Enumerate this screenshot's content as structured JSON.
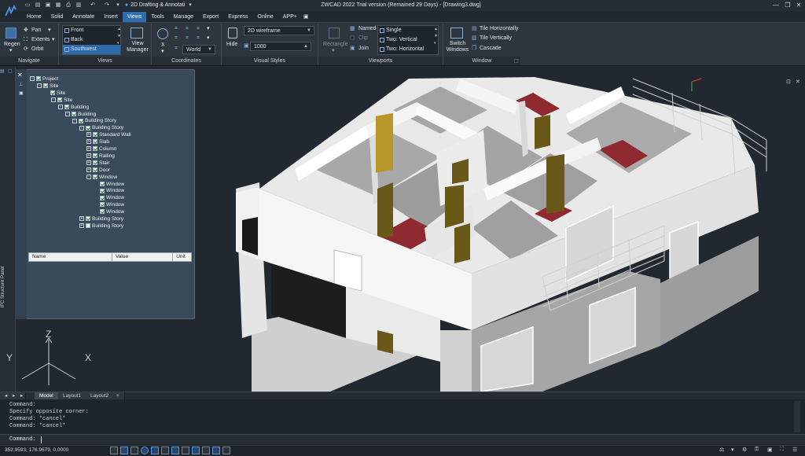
{
  "titlebar": {
    "workspace": "2D Drafting & Annotati",
    "app_title": "ZWCAD 2022 Trial version (Remained 29 Days) - [Drawing3.dwg]"
  },
  "menu": [
    "Home",
    "Solid",
    "Annotate",
    "Insert",
    "Views",
    "Tools",
    "Manage",
    "Export",
    "Express",
    "Online",
    "APP+"
  ],
  "menu_active": "Views",
  "ribbon": {
    "navigate": {
      "label": "Navigate",
      "regen": "Regen",
      "pan": "Pan",
      "extents": "Extents",
      "orbit": "Orbit"
    },
    "views": {
      "label": "Views",
      "items": [
        "Front",
        "Back",
        "Southwest"
      ],
      "selected": "Southwest",
      "view_manager": "View\nManager"
    },
    "coordinates": {
      "label": "Coordinates",
      "x": "X",
      "ucs": "World"
    },
    "visual_styles": {
      "label": "Visual Styles",
      "hide": "Hide",
      "style": "2D wireframe",
      "value": "1000"
    },
    "viewports": {
      "label": "Viewports",
      "rectangle": "Rectangle",
      "named": "Named",
      "clip": "Clip",
      "join": "Join",
      "single": "Single",
      "two_vertical": "Two: Vertical",
      "two_horizontal": "Two: Horizontal"
    },
    "window": {
      "label": "Window",
      "switch": "Switch\nWindows",
      "tile_h": "Tile Horizontally",
      "tile_v": "Tile Vertically",
      "cascade": "Cascade"
    }
  },
  "panel": {
    "title": "IFC Structure Panel",
    "tree": [
      {
        "label": "Project",
        "level": 0,
        "pm": "-",
        "checked": true
      },
      {
        "label": "Site",
        "level": 1,
        "pm": "-",
        "checked": true
      },
      {
        "label": "Site",
        "level": 2,
        "pm": "",
        "checked": true
      },
      {
        "label": "Site",
        "level": 3,
        "pm": "-",
        "checked": true
      },
      {
        "label": "Building",
        "level": 4,
        "pm": "-",
        "checked": true
      },
      {
        "label": "Building",
        "level": 5,
        "pm": "-",
        "checked": true
      },
      {
        "label": "Building Story",
        "level": 6,
        "pm": "-",
        "checked": true
      },
      {
        "label": "Building Story",
        "level": 7,
        "pm": "-",
        "checked": true
      },
      {
        "label": "Standard Wall",
        "level": 8,
        "pm": "+",
        "checked": true
      },
      {
        "label": "Slab",
        "level": 8,
        "pm": "+",
        "checked": true
      },
      {
        "label": "Column",
        "level": 8,
        "pm": "+",
        "checked": true
      },
      {
        "label": "Railing",
        "level": 8,
        "pm": "+",
        "checked": true
      },
      {
        "label": "Stair",
        "level": 8,
        "pm": "+",
        "checked": true
      },
      {
        "label": "Door",
        "level": 8,
        "pm": "+",
        "checked": true
      },
      {
        "label": "Window",
        "level": 8,
        "pm": "-",
        "checked": true
      },
      {
        "label": "Window",
        "level": 9,
        "pm": "",
        "checked": true
      },
      {
        "label": "Window",
        "level": 9,
        "pm": "",
        "checked": true
      },
      {
        "label": "Window",
        "level": 9,
        "pm": "",
        "checked": true
      },
      {
        "label": "Window",
        "level": 9,
        "pm": "",
        "checked": true
      },
      {
        "label": "Window",
        "level": 9,
        "pm": "",
        "checked": true
      },
      {
        "label": "Building Story",
        "level": 7,
        "pm": "+",
        "checked": true
      },
      {
        "label": "Building Story",
        "level": 7,
        "pm": "+",
        "checked": false
      }
    ],
    "props_headers": [
      "Name",
      "Value",
      "Unit"
    ]
  },
  "ucs": {
    "z": "Z",
    "y": "Y",
    "x": "X"
  },
  "layout_tabs": [
    "Model",
    "Layout1",
    "Layout2",
    "+"
  ],
  "command": {
    "lines": [
      "Command:",
      "Specify opposite corner:",
      "Command: *cancel*",
      "Command: *cancel*"
    ],
    "prompt": "Command:"
  },
  "status": {
    "coords": "352.9593, 176.9679, 0.0000"
  }
}
